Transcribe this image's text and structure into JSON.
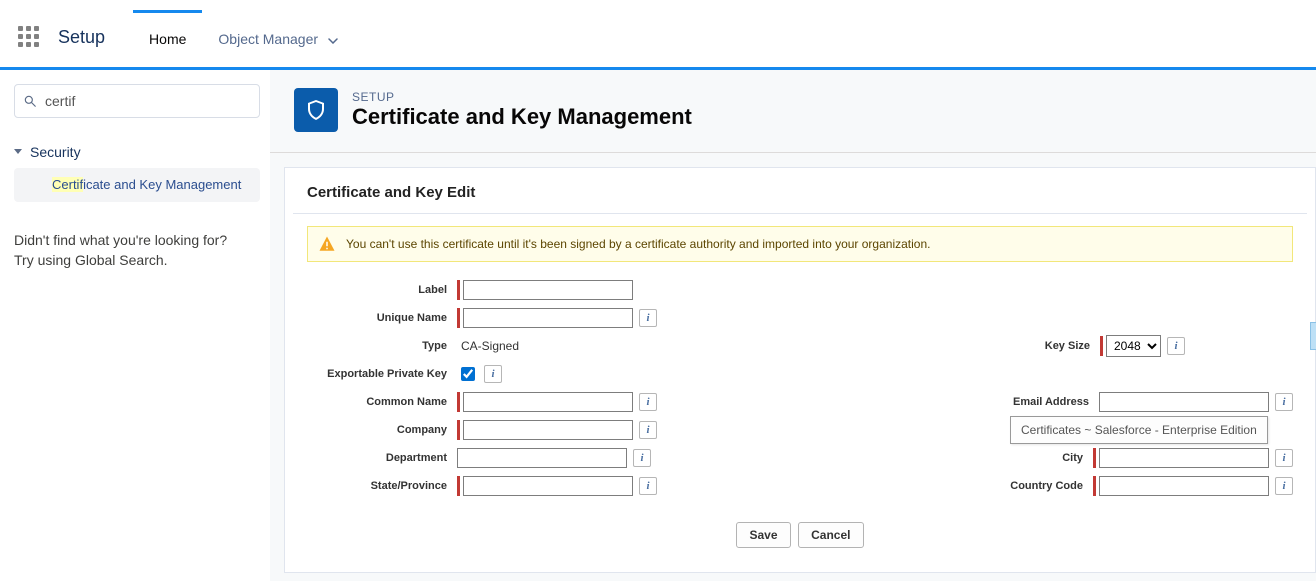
{
  "topbar": {
    "app_name": "Setup",
    "tabs": [
      {
        "label": "Home",
        "active": true
      },
      {
        "label": "Object Manager",
        "active": false
      }
    ]
  },
  "sidebar": {
    "search_value": "certif",
    "category": "Security",
    "item_highlight": "Certif",
    "item_rest": "icate and Key Management",
    "not_found": "Didn't find what you're looking for? Try using Global Search."
  },
  "page_header": {
    "eyebrow": "SETUP",
    "title": "Certificate and Key Management"
  },
  "panel": {
    "title": "Certificate and Key Edit",
    "warning": "You can't use this certificate until it's been signed by a certificate authority and imported into your organization."
  },
  "form": {
    "labels": {
      "label": "Label",
      "unique_name": "Unique Name",
      "type": "Type",
      "exportable": "Exportable Private Key",
      "common_name": "Common Name",
      "company": "Company",
      "department": "Department",
      "state": "State/Province",
      "key_size": "Key Size",
      "email": "Email Address",
      "city": "City",
      "country": "Country Code"
    },
    "values": {
      "label": "",
      "unique_name": "",
      "type": "CA-Signed",
      "exportable_checked": true,
      "common_name": "",
      "company": "",
      "department": "",
      "state": "",
      "key_size_selected": "2048",
      "email": "",
      "city": "",
      "country": ""
    },
    "tooltip": "Certificates ~ Salesforce - Enterprise Edition",
    "key_size_options": [
      "2048"
    ]
  },
  "buttons": {
    "save": "Save",
    "cancel": "Cancel"
  }
}
